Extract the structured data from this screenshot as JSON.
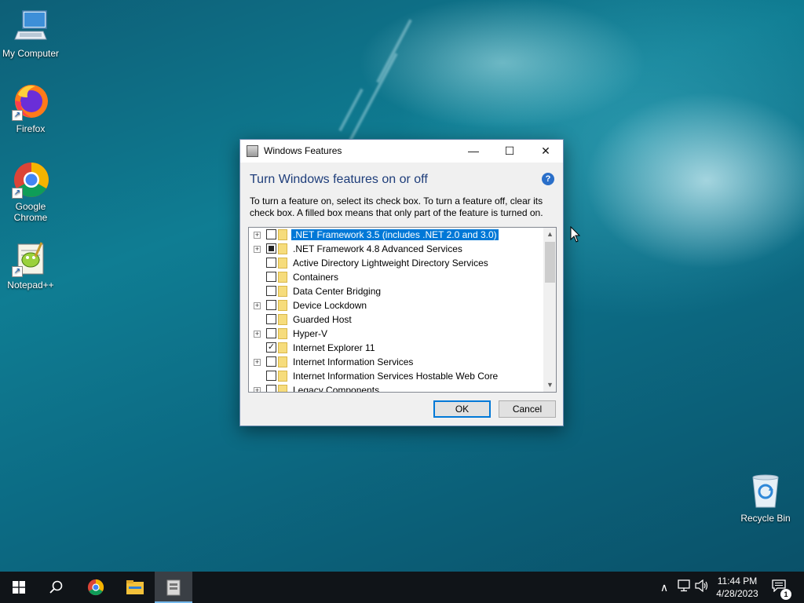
{
  "desktop": {
    "icons": [
      {
        "label": "My Computer",
        "icon": "computer-icon"
      },
      {
        "label": "Firefox",
        "icon": "firefox-icon"
      },
      {
        "label": "Google Chrome",
        "icon": "chrome-icon"
      },
      {
        "label": "Notepad++",
        "icon": "notepadpp-icon"
      },
      {
        "label": "Recycle Bin",
        "icon": "recycle-bin-icon"
      }
    ]
  },
  "window": {
    "title": "Windows Features",
    "controls": {
      "minimize": "—",
      "maximize": "☐",
      "close": "✕"
    },
    "heading": "Turn Windows features on or off",
    "help": "?",
    "description": "To turn a feature on, select its check box. To turn a feature off, clear its check box. A filled box means that only part of the feature is turned on.",
    "features": [
      {
        "label": ".NET Framework 3.5 (includes .NET 2.0 and 3.0)",
        "expandable": true,
        "state": "unchecked",
        "selected": true
      },
      {
        "label": ".NET Framework 4.8 Advanced Services",
        "expandable": true,
        "state": "partial",
        "selected": false
      },
      {
        "label": "Active Directory Lightweight Directory Services",
        "expandable": false,
        "state": "unchecked",
        "selected": false
      },
      {
        "label": "Containers",
        "expandable": false,
        "state": "unchecked",
        "selected": false
      },
      {
        "label": "Data Center Bridging",
        "expandable": false,
        "state": "unchecked",
        "selected": false
      },
      {
        "label": "Device Lockdown",
        "expandable": true,
        "state": "unchecked",
        "selected": false
      },
      {
        "label": "Guarded Host",
        "expandable": false,
        "state": "unchecked",
        "selected": false
      },
      {
        "label": "Hyper-V",
        "expandable": true,
        "state": "unchecked",
        "selected": false
      },
      {
        "label": "Internet Explorer 11",
        "expandable": false,
        "state": "checked",
        "selected": false
      },
      {
        "label": "Internet Information Services",
        "expandable": true,
        "state": "unchecked",
        "selected": false
      },
      {
        "label": "Internet Information Services Hostable Web Core",
        "expandable": false,
        "state": "unchecked",
        "selected": false
      },
      {
        "label": "Legacy Components",
        "expandable": true,
        "state": "unchecked",
        "selected": false
      }
    ],
    "ok_label": "OK",
    "cancel_label": "Cancel"
  },
  "taskbar": {
    "time": "11:44 PM",
    "date": "4/28/2023",
    "notification_count": "1"
  },
  "colors": {
    "accent": "#0078d7",
    "heading": "#1e3d7a",
    "taskbar": "#101418"
  }
}
